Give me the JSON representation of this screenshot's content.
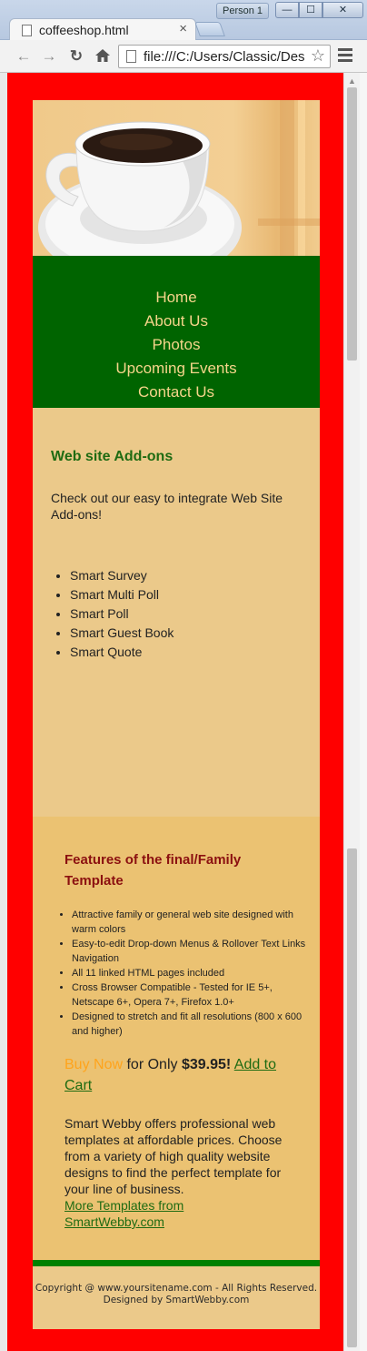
{
  "browser": {
    "tab_title": "coffeeshop.html",
    "tab_close": "×",
    "profile": "Person 1",
    "url": "file:///C:/Users/Classic/Des",
    "window_controls": {
      "minimize": "—",
      "maximize": "☐",
      "close": "✕"
    }
  },
  "site": {
    "nav": [
      "Home",
      "About Us",
      "Photos",
      "Upcoming Events",
      "Contact Us"
    ],
    "main": {
      "heading": "Web site Add-ons",
      "intro": "Check out our easy to integrate Web Site Add-ons!",
      "addons": [
        "Smart Survey",
        "Smart Multi Poll",
        "Smart Poll",
        "Smart Guest Book",
        "Smart Quote"
      ]
    },
    "side": {
      "heading": "Features of the final/Family Template",
      "features": [
        "Attractive family or general web site designed with warm colors",
        "Easy-to-edit Drop-down Menus & Rollover Text Links Navigation",
        "All 11 linked HTML pages included",
        "Cross Browser Compatible - Tested for IE 5+, Netscape 6+, Opera 7+, Firefox 1.0+",
        "Designed to stretch and fit all resolutions (800 x 600 and higher)"
      ],
      "buy_now": "Buy Now",
      "for_only": " for Only ",
      "price": "$39.95!",
      "add_to_cart": "Add to Cart",
      "about": "Smart Webby offers professional web templates at affordable prices. Choose from a variety of high quality website designs to find the perfect template for your line of business.",
      "more_link": "More Templates from SmartWebby.com"
    },
    "footer": "Copyright @ www.yoursitename.com - All Rights Reserved. Designed by SmartWebby.com"
  },
  "colors": {
    "page_background": "#ff0000",
    "nav_background": "#006400",
    "nav_text": "#f5d58a",
    "heading_green": "#1f6b12",
    "heading_red": "#8b1010",
    "buy_now": "#ffa41c"
  },
  "icons": [
    "back-arrow-icon",
    "forward-arrow-icon",
    "reload-icon",
    "home-icon",
    "page-icon",
    "star-icon",
    "menu-icon",
    "coffee-cup-image"
  ]
}
